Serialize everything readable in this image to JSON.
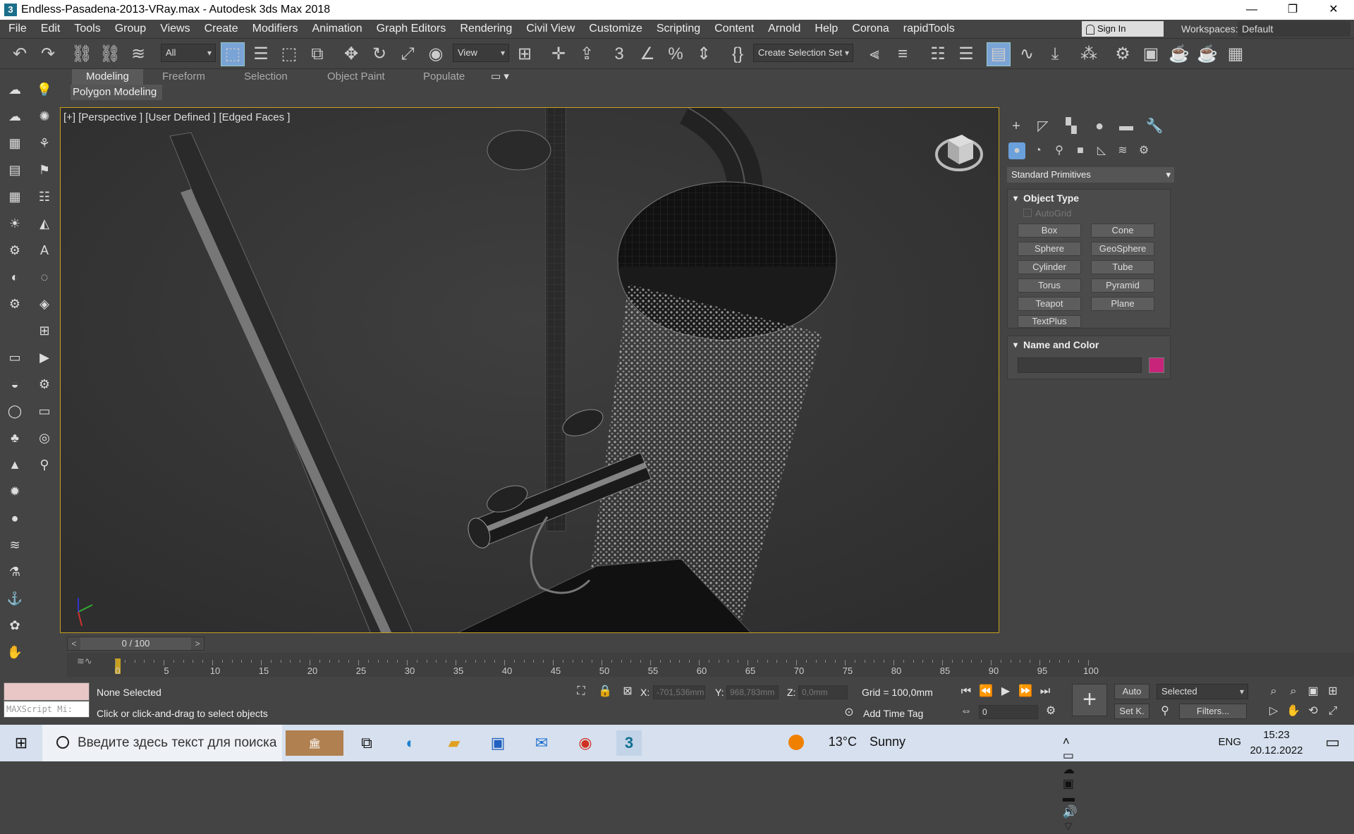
{
  "window": {
    "title": "Endless-Pasadena-2013-VRay.max - Autodesk 3ds Max 2018",
    "app_icon": "3",
    "controls": [
      "—",
      "❐",
      "✕"
    ]
  },
  "menu": [
    "File",
    "Edit",
    "Tools",
    "Group",
    "Views",
    "Create",
    "Modifiers",
    "Animation",
    "Graph Editors",
    "Rendering",
    "Civil View",
    "Customize",
    "Scripting",
    "Content",
    "Arnold",
    "Help",
    "Corona",
    "rapidTools"
  ],
  "signin": "Sign In",
  "workspaces_label": "Workspaces:",
  "workspace_value": "Default",
  "toolbar": {
    "filter_value": "All",
    "ref_coord": "View",
    "selection_set": "Create Selection Set"
  },
  "ribbon": {
    "tabs": [
      "Modeling",
      "Freeform",
      "Selection",
      "Object Paint",
      "Populate"
    ],
    "active": "Modeling",
    "panel": "Polygon Modeling"
  },
  "viewport": {
    "label": "[+] [Perspective ] [User Defined ] [Edged Faces ]"
  },
  "command_panel": {
    "category": "Standard Primitives",
    "object_type_title": "Object Type",
    "autogrid": "AutoGrid",
    "buttons": [
      "Box",
      "Cone",
      "Sphere",
      "GeoSphere",
      "Cylinder",
      "Tube",
      "Torus",
      "Pyramid",
      "Teapot",
      "Plane",
      "TextPlus"
    ],
    "name_color_title": "Name and Color",
    "object_color": "#c8257a"
  },
  "timeline": {
    "slider_value": "0 / 100",
    "ticks": [
      "0",
      "5",
      "10",
      "15",
      "20",
      "25",
      "30",
      "35",
      "40",
      "45",
      "50",
      "55",
      "60",
      "65",
      "70",
      "75",
      "80",
      "85",
      "90",
      "95",
      "100"
    ]
  },
  "status": {
    "maxscript_placeholder": "MAXScript Mi:",
    "selection": "None Selected",
    "prompt": "Click or click-and-drag to select objects",
    "x_label": "X:",
    "x_value": "-701,536mm",
    "y_label": "Y:",
    "y_value": "968,783mm",
    "z_label": "Z:",
    "z_value": "0,0mm",
    "grid": "Grid = 100,0mm",
    "add_time_tag": "Add Time Tag",
    "frame_value": "0",
    "auto": "Auto",
    "set_key": "Set K.",
    "key_filter": "Selected",
    "filters": "Filters..."
  },
  "taskbar": {
    "search_placeholder": "Введите здесь текст для поиска",
    "temperature": "13°C",
    "weather": "Sunny",
    "lang": "ENG",
    "time": "15:23",
    "date": "20.12.2022"
  }
}
